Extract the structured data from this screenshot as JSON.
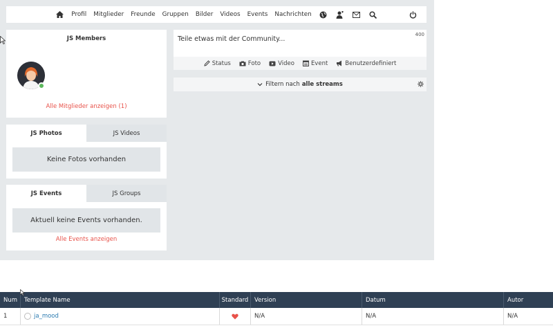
{
  "nav": {
    "items": [
      "Profil",
      "Mitglieder",
      "Freunde",
      "Gruppen",
      "Bilder",
      "Videos",
      "Events",
      "Nachrichten"
    ],
    "icons": [
      "home-icon",
      "globe-icon",
      "friend-request-icon",
      "mail-icon",
      "search-icon",
      "power-icon"
    ]
  },
  "members": {
    "title": "JS Members",
    "show_all": "Alle Mitglieder anzeigen (1)"
  },
  "photos": {
    "tab_active": "JS Photos",
    "tab_inactive": "JS Videos",
    "empty": "Keine Fotos vorhanden"
  },
  "events": {
    "tab_active": "JS Events",
    "tab_inactive": "JS Groups",
    "empty": "Aktuell keine Events vorhanden.",
    "link": "Alle Events anzeigen"
  },
  "composer": {
    "placeholder": "Teile etwas mit der Community...",
    "char_count": "400",
    "actions": [
      "Status",
      "Foto",
      "Video",
      "Event",
      "Benutzerdefiniert"
    ]
  },
  "filter": {
    "prefix": "Filtern nach",
    "value": "alle streams"
  },
  "table": {
    "headers": [
      "Num",
      "Template Name",
      "Standard",
      "Version",
      "Datum",
      "Autor"
    ],
    "rows": [
      {
        "num": "1",
        "name": "ja_mood",
        "version": "N/A",
        "date": "N/A",
        "author": "N/A"
      }
    ]
  },
  "colors": {
    "accent_red": "#e8524a",
    "header_dark": "#2f4054",
    "online": "#5cb85c"
  }
}
